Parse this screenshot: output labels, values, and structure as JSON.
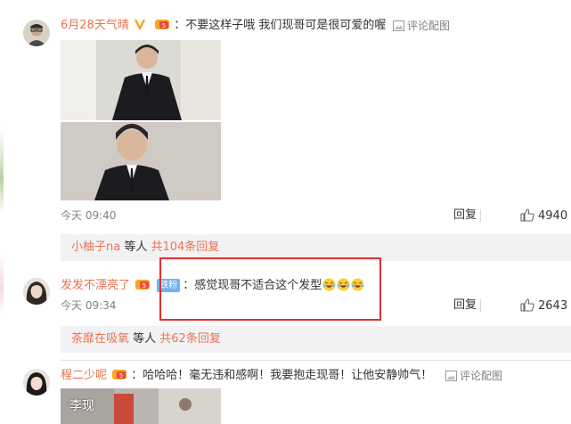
{
  "comments": [
    {
      "username": "6月28天气晴",
      "text": "：不要这样子哦 我们现哥可是很可爱的喔",
      "image_action": "评论配图",
      "time": "今天 09:40",
      "reply": "回复",
      "likes": "4940",
      "sub": {
        "who": "小柚子na",
        "etc": " 等人 ",
        "more": "共104条回复"
      }
    },
    {
      "username": "发发不漂亮了",
      "fan_tag": "铁粉",
      "text": "：感觉现哥不适合这个发型",
      "time": "今天 09:34",
      "reply": "回复",
      "likes": "2643",
      "sub": {
        "who": "茶靡在吸氧",
        "etc": " 等人 ",
        "more": "共62条回复"
      }
    },
    {
      "username": "程二少呢",
      "text": "：哈哈哈！毫无违和感啊！我要抱走现哥！让他安静帅气！",
      "image_action": "评论配图",
      "photo_caption": "李现"
    }
  ],
  "colors": {
    "username": "#eb7350",
    "highlight": "#e0302c",
    "subbar": "#f2f2f5"
  }
}
